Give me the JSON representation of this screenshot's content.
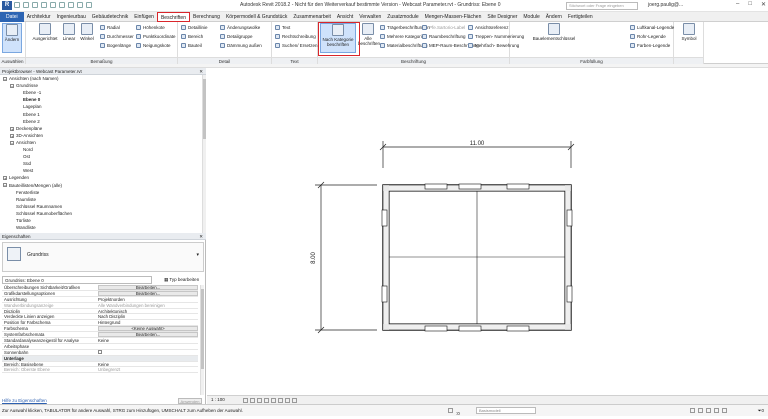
{
  "window": {
    "title": "Autodesk Revit 2018.2 - Nicht für den Weiterverkauf bestimmte Version - Webcast Parameter.rvt - Grundriss: Ebene 0",
    "search_placeholder": "Stichwort oder Frage eingeben",
    "user": "joerg.paulig@..."
  },
  "tabs": [
    {
      "label": "Datei"
    },
    {
      "label": "Architektur"
    },
    {
      "label": "Ingenieurbau"
    },
    {
      "label": "Gebäudetechnik"
    },
    {
      "label": "Einfügen"
    },
    {
      "label": "Beschriften"
    },
    {
      "label": "Berechnung"
    },
    {
      "label": "Körpermodell & Grundstück"
    },
    {
      "label": "Zusammenarbeit"
    },
    {
      "label": "Ansicht"
    },
    {
      "label": "Verwalten"
    },
    {
      "label": "Zusatzmodule"
    },
    {
      "label": "Mengen-Massen-Flächen"
    },
    {
      "label": "Site Designer"
    },
    {
      "label": "Module"
    },
    {
      "label": "Ändern"
    },
    {
      "label": "Fertigteilen"
    }
  ],
  "ribbon": {
    "select": {
      "title": "Auswählen",
      "modify": "Ändern"
    },
    "dimension": {
      "title": "Bemaßung",
      "aligned": "Ausgerichtet",
      "linear": "Linear",
      "angular": "Winkel",
      "radial": "Radial",
      "diameter": "Durchmesser",
      "arc_length": "Bogenlänge",
      "spot_elevation": "Höhenkote",
      "spot_coordinate": "Punktkoordinate",
      "spot_slope": "Neigungskote"
    },
    "detail": {
      "title": "Detail",
      "detail_line": "Detaillinie",
      "region": "Bereich",
      "component": "Bauteil",
      "revision_cloud": "Änderungswolke",
      "detail_group": "Detailgruppe",
      "insulation": "Dämmung außen"
    },
    "text": {
      "title": "Text",
      "text": "Text",
      "spelling": "Rechtschreibung",
      "find_replace": "Suchen/ Ersetzen"
    },
    "tag": {
      "title": "Beschriftung",
      "by_category": "Nach Kategorie beschriften",
      "all": "Alle beschriften",
      "beam": "Trägerbeschriftungen",
      "multi_category": "Mehrere Kategorien",
      "material": "Materialbeschriftung",
      "stair_path": "Pfe.Sartorio-Label",
      "room": "Raumbeschriftung",
      "mep_room": "MEP-Raum-Beschriftung",
      "view_ref": "Ansichtsreferenz",
      "tread_number": "Treppen- Nummerierung",
      "multi_rebar": "Mehrfach- Bewehrung"
    },
    "color_fill": {
      "title": "Farbfüllung",
      "keynote": "Bauelementschlüssel",
      "duct_legend": "Luftkanal-Legende",
      "pipe_legend": "Rohr-Legende",
      "color_legend": "Farben-Legende"
    },
    "symbol": {
      "title": "",
      "symbol": "Symbol"
    }
  },
  "project_browser": {
    "title": "Projektbrowser - Webcast Parameter.rvt",
    "items": [
      {
        "label": "Ansichten (nach Namen)",
        "level": 0,
        "toggle": "−"
      },
      {
        "label": "Grundrisse",
        "level": 1,
        "toggle": "−"
      },
      {
        "label": "Ebene -1",
        "level": 2
      },
      {
        "label": "Ebene 0",
        "level": 2,
        "bold": true
      },
      {
        "label": "Lageplan",
        "level": 2
      },
      {
        "label": "Ebene 1",
        "level": 2
      },
      {
        "label": "Ebene 2",
        "level": 2
      },
      {
        "label": "Deckenpläne",
        "level": 1,
        "toggle": "+"
      },
      {
        "label": "3D-Ansichten",
        "level": 1,
        "toggle": "+"
      },
      {
        "label": "Ansichten",
        "level": 1,
        "toggle": "−"
      },
      {
        "label": "Nord",
        "level": 2
      },
      {
        "label": "Ost",
        "level": 2
      },
      {
        "label": "Süd",
        "level": 2
      },
      {
        "label": "West",
        "level": 2
      },
      {
        "label": "Legenden",
        "level": 0,
        "toggle": "+"
      },
      {
        "label": "Bauteillisten/Mengen (alle)",
        "level": 0,
        "toggle": "−"
      },
      {
        "label": "Fensterliste",
        "level": 1
      },
      {
        "label": "Raumliste",
        "level": 1
      },
      {
        "label": "Schlüssel Raumnamen",
        "level": 1
      },
      {
        "label": "Schlüssel Raumoberflächen",
        "level": 1
      },
      {
        "label": "Türliste",
        "level": 1
      },
      {
        "label": "Wandliste",
        "level": 1
      }
    ]
  },
  "properties": {
    "title": "Eigenschaften",
    "type_name": "Grundriss",
    "filter": "Grundriss: Ebene 0",
    "edit_type": "Typ bearbeiten",
    "rows": [
      {
        "k": "Überschreibungen Sichtbarkeit/Grafiken",
        "v": "Bearbeiten...",
        "btn": true
      },
      {
        "k": "Grafikdarstellungsoptionen",
        "v": "Bearbeiten...",
        "btn": true
      },
      {
        "k": "Ausrichtung",
        "v": "Projektnorden"
      },
      {
        "k": "Wandverbindungsanzeige",
        "v": "Alle Wandverbindungen bereinigen",
        "grey": true
      },
      {
        "k": "Disziplin",
        "v": "Architektonisch"
      },
      {
        "k": "Verdeckte Linien anzeigen",
        "v": "Nach Disziplin"
      },
      {
        "k": "Position für Farbschema",
        "v": "Hintergrund"
      },
      {
        "k": "Farbschema",
        "v": "<Keine Auswahl>",
        "btn": true
      },
      {
        "k": "Systemfarbschemata",
        "v": "Bearbeiten...",
        "btn": true
      },
      {
        "k": "Standardanalyseanzeigestil für Analyse",
        "v": "Keine"
      },
      {
        "k": "Arbeitsphase",
        "v": ""
      },
      {
        "k": "Sonnenbahn",
        "v": "",
        "checkbox": true
      },
      {
        "k": "Unterlage",
        "v": "",
        "group": true
      },
      {
        "k": "Bereich: Basisebene",
        "v": "Keine"
      },
      {
        "k": "Bereich: Oberste Ebene",
        "v": "Unbegrenzt",
        "grey": true
      }
    ],
    "help_link": "Hilfe zu Eigenschaften",
    "apply": "Anwenden"
  },
  "canvas": {
    "dim_horizontal": "11.00",
    "dim_vertical": "8.00"
  },
  "viewbar": {
    "scale": "1 : 100"
  },
  "statusbar": {
    "message": "Zur Auswahl klicken, TABULATOR für andere Auswahl, STRG zum Hinzufügen, UMSCHALT zum Aufheben der Auswahl.",
    "counter": ":0",
    "model": "Basismodell",
    "filter_count": "0"
  }
}
